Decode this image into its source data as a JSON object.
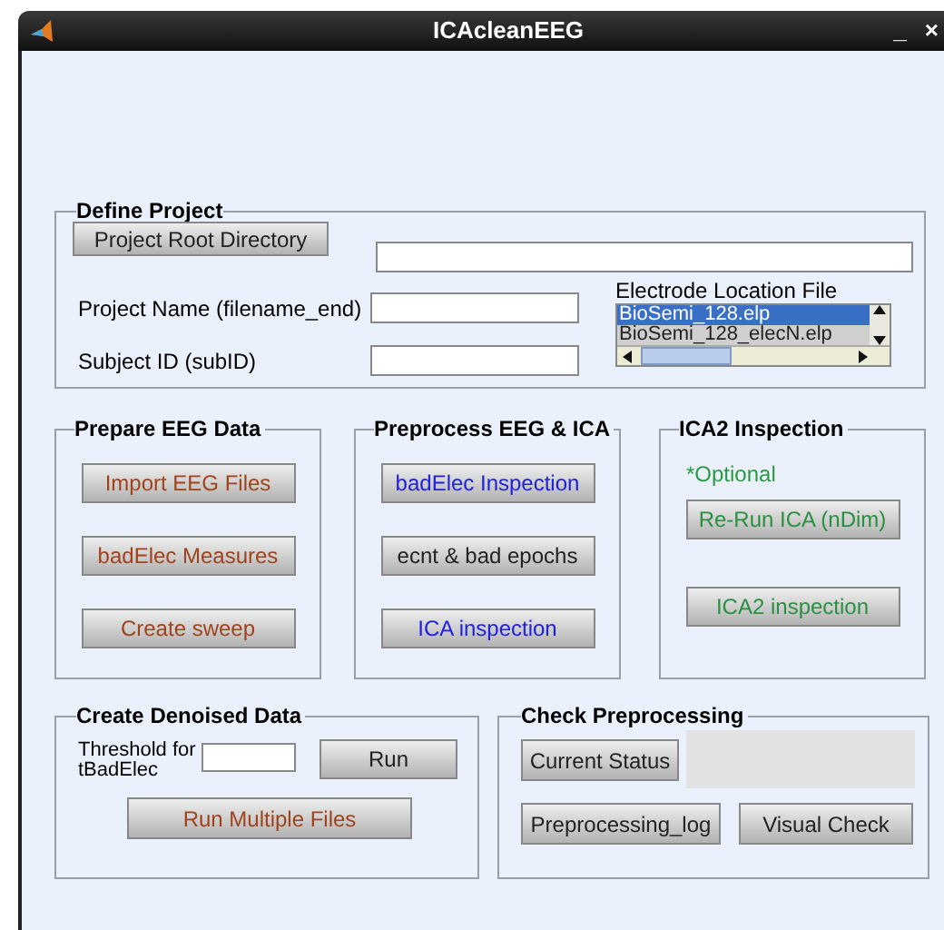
{
  "window": {
    "title": "ICAcleanEEG",
    "controls": [
      "_",
      "×"
    ]
  },
  "define_project": {
    "title": "Define Project",
    "root_button": "Project Root Directory",
    "fields": [
      {
        "label": "Project Name (filename_end)"
      },
      {
        "label": "Subject ID (subID)"
      }
    ],
    "electrode_list": {
      "label": "Electrode Location File",
      "items": [
        {
          "text": "BioSemi_128.elp",
          "selected": true
        },
        {
          "text": "BioSemi_128_elecN.elp",
          "selected": false
        }
      ]
    }
  },
  "panels": [
    {
      "title": "Prepare EEG Data",
      "buttons": [
        {
          "label": "Import EEG Files",
          "color": "#a0431a"
        },
        {
          "label": "badElec Measures",
          "color": "#a0431a"
        },
        {
          "label": "Create sweep",
          "color": "#a0431a"
        }
      ]
    },
    {
      "title": "Preprocess EEG & ICA",
      "buttons": [
        {
          "label": "badElec Inspection",
          "color": "#2020e0"
        },
        {
          "label": "ecnt & bad epochs",
          "color": "#222222"
        },
        {
          "label": "ICA inspection",
          "color": "#2020e0"
        }
      ]
    },
    {
      "title": "ICA2 Inspection",
      "note": "*Optional",
      "buttons": [
        {
          "label": "Re-Run ICA (nDim)",
          "color": "#2a9040"
        },
        {
          "label": "ICA2 inspection",
          "color": "#2a9040"
        }
      ]
    }
  ],
  "create_denoised": {
    "title": "Create Denoised Data",
    "threshold_label": "Threshold for tBadElec",
    "run_button": {
      "label": "Run",
      "color": "#222222"
    },
    "multi_button": {
      "label": "Run Multiple Files",
      "color": "#a0431a"
    }
  },
  "check_preprocessing": {
    "title": "Check Preprocessing",
    "status_button": "Current Status",
    "log_button": "Preprocessing_log",
    "visual_button": "Visual Check"
  }
}
